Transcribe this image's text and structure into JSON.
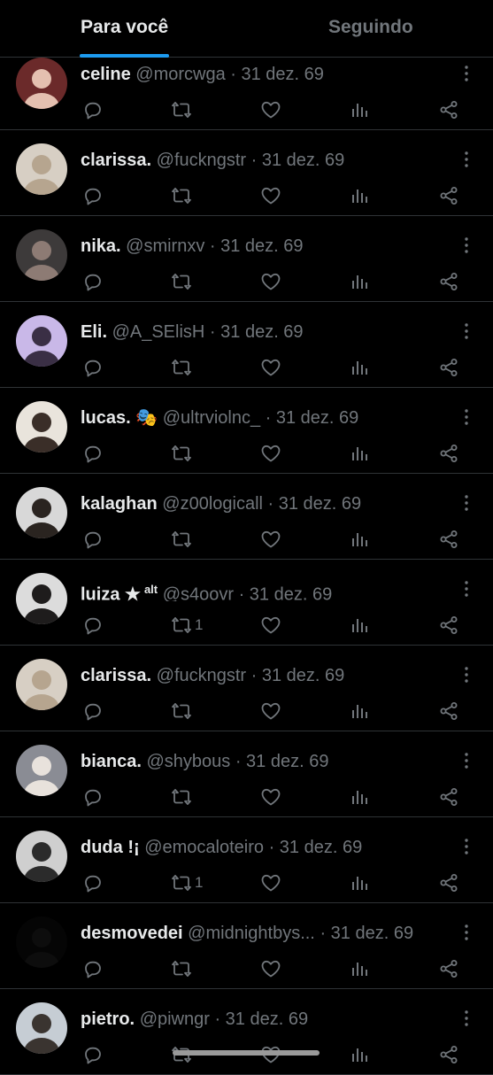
{
  "tabs": [
    {
      "label": "Para você",
      "active": true
    },
    {
      "label": "Seguindo",
      "active": false
    }
  ],
  "accent_color": "#1d9bf0",
  "posts": [
    {
      "name": "celine",
      "handle": "@morcwga",
      "date": "· 31 dez. 69",
      "retweets": "",
      "avatar": {
        "bg": "#6b2a2a",
        "fg": "#e4c0b0"
      }
    },
    {
      "name": "clarissa.",
      "handle": "@fuckngstr",
      "date": "· 31 dez. 69",
      "retweets": "",
      "avatar": {
        "bg": "#d7cfc4",
        "fg": "#b6a58f"
      }
    },
    {
      "name": "nika.",
      "handle": "@smirnxv",
      "date": "· 31 dez. 69",
      "retweets": "",
      "avatar": {
        "bg": "#3d3a3a",
        "fg": "#8d7b74"
      }
    },
    {
      "name": "Eli.",
      "handle": "@A_SElisH",
      "date": "· 31 dez. 69",
      "retweets": "",
      "avatar": {
        "bg": "#c9b8e8",
        "fg": "#3a2f45"
      }
    },
    {
      "name": "lucas.",
      "emoji": "🎭",
      "handle": "@ultrviolnc_",
      "date": "· 31 dez. 69",
      "retweets": "",
      "avatar": {
        "bg": "#e9e4dc",
        "fg": "#3a2e28"
      }
    },
    {
      "name": "kalaghan",
      "handle": "@z00logicall",
      "date": "· 31 dez. 69",
      "retweets": "",
      "avatar": {
        "bg": "#d8d8d8",
        "fg": "#2a2420"
      }
    },
    {
      "name": "luiza ★",
      "sup": "alt",
      "handle": "@s4oovr",
      "date": "· 31 dez. 69",
      "retweets": "1",
      "avatar": {
        "bg": "#dcdcdc",
        "fg": "#1e1c1c"
      }
    },
    {
      "name": "clarissa.",
      "handle": "@fuckngstr",
      "date": "· 31 dez. 69",
      "retweets": "",
      "avatar": {
        "bg": "#d7cfc4",
        "fg": "#b6a58f"
      }
    },
    {
      "name": "bianca.",
      "handle": "@shybous",
      "date": "· 31 dez. 69",
      "retweets": "",
      "avatar": {
        "bg": "#8a8c94",
        "fg": "#e8e2dc"
      }
    },
    {
      "name": "duda !¡",
      "handle": "@emocaloteiro",
      "date": "· 31 dez. 69",
      "retweets": "1",
      "avatar": {
        "bg": "#cfcfcf",
        "fg": "#2b2b2b"
      }
    },
    {
      "name": "desmovedei",
      "handle": "@midnightbys...",
      "date": "· 31 dez. 69",
      "retweets": "",
      "avatar": {
        "bg": "#050505",
        "fg": "#0d0d0d"
      }
    },
    {
      "name": "pietro.",
      "handle": "@piwngr",
      "date": "· 31 dez. 69",
      "retweets": "",
      "avatar": {
        "bg": "#c6cdd4",
        "fg": "#3a3430"
      }
    }
  ]
}
